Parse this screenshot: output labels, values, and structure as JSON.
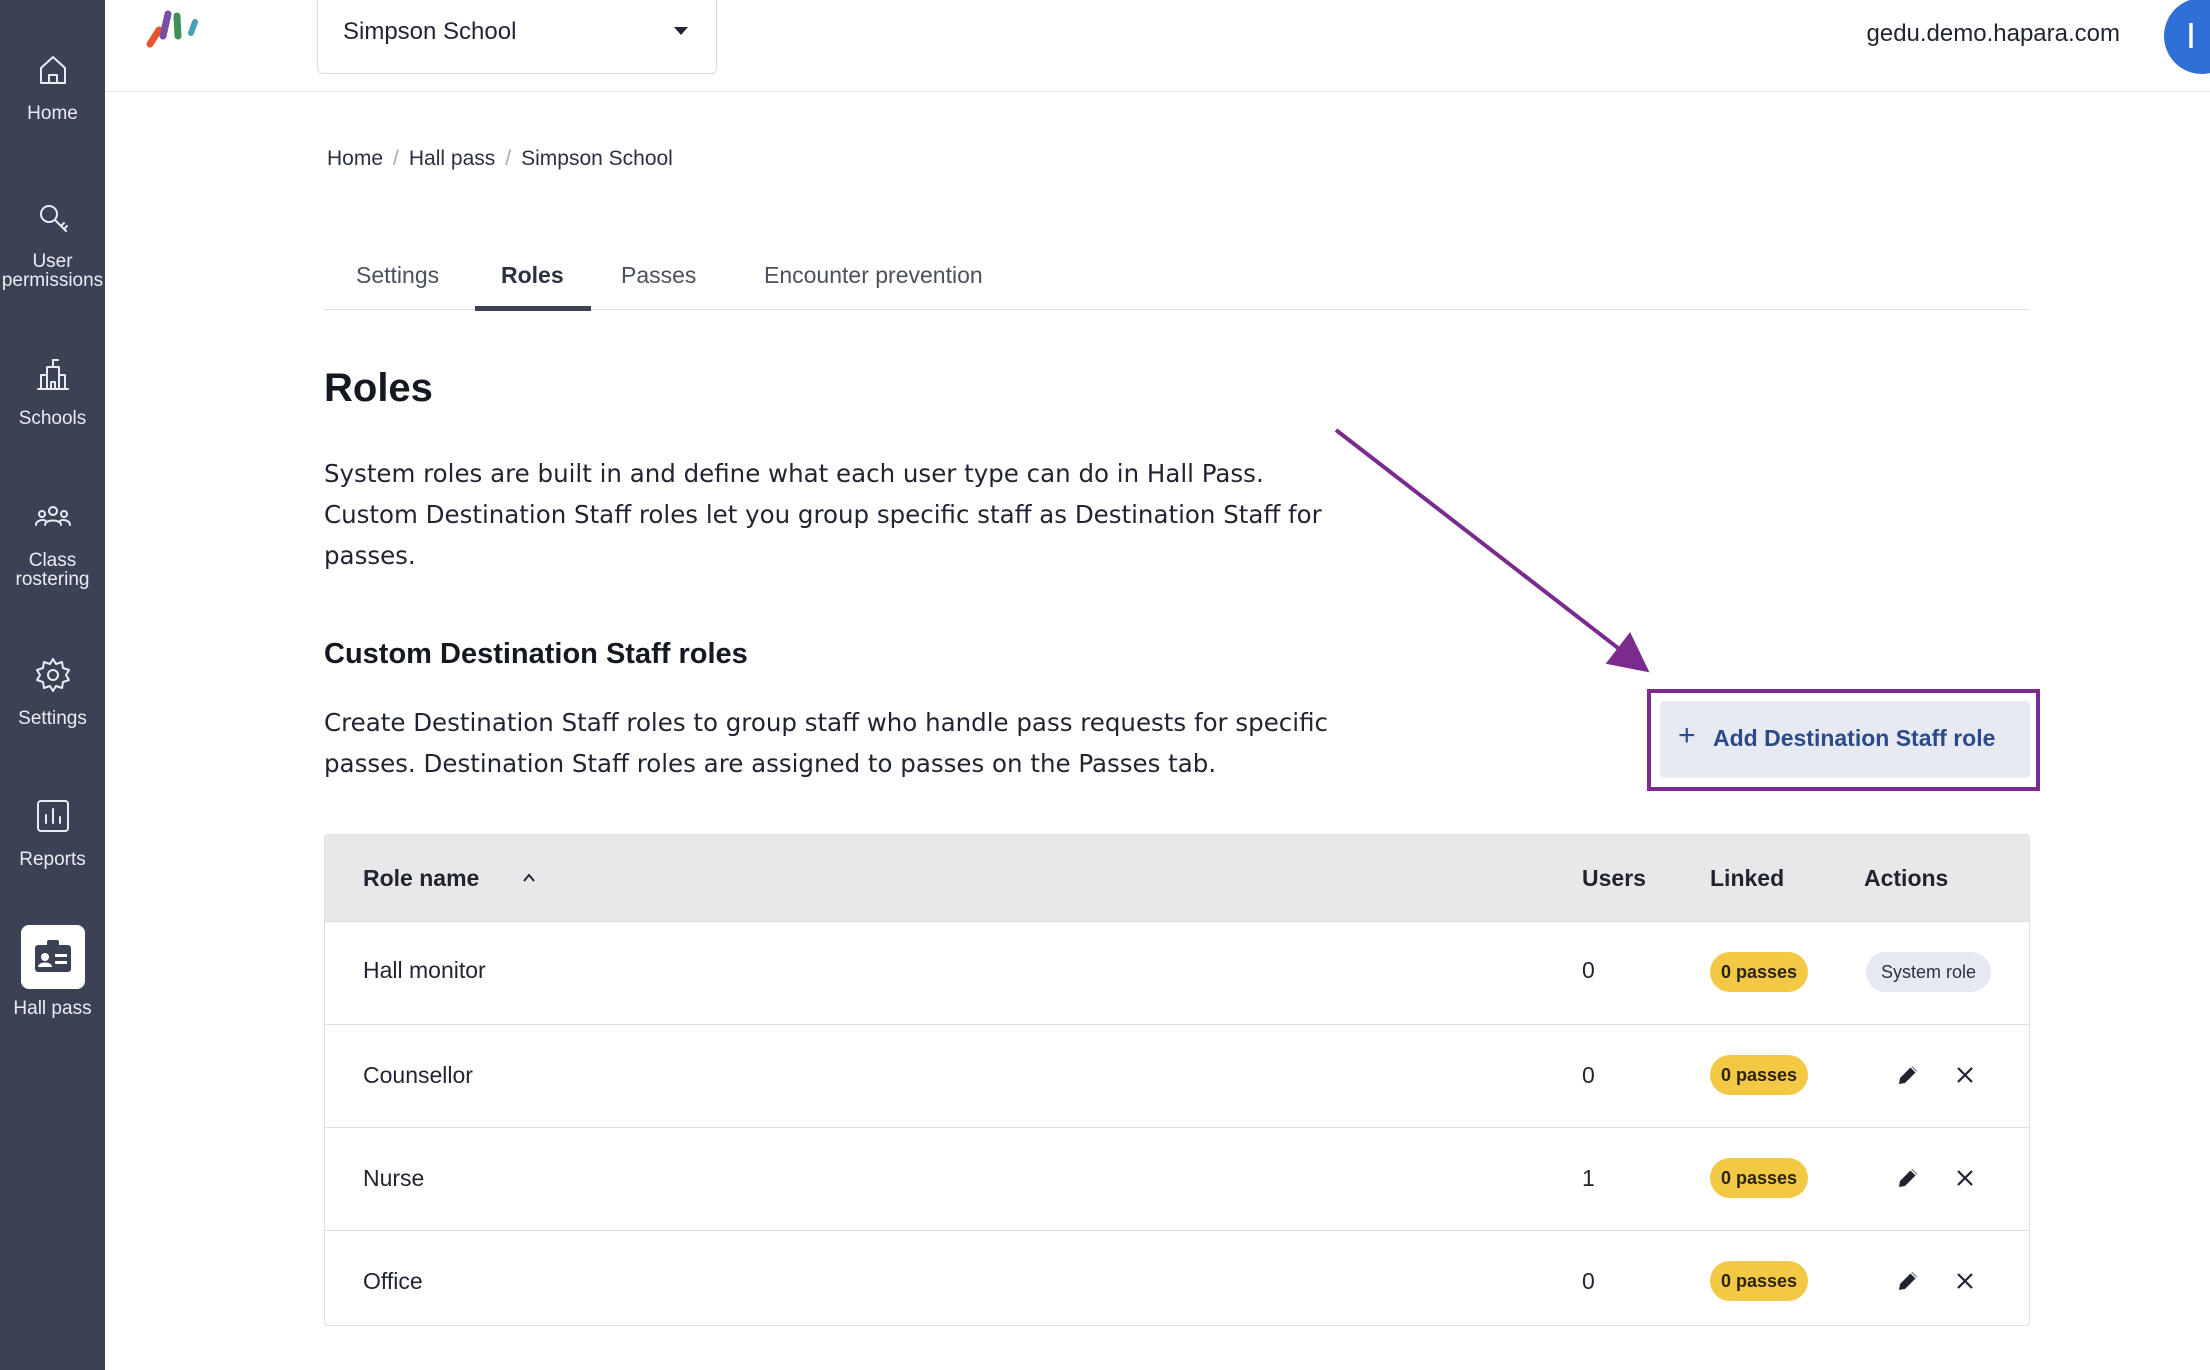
{
  "sidebar": {
    "items": [
      {
        "label": "Home",
        "icon": "home-icon"
      },
      {
        "label": "User\npermissions",
        "icon": "key-icon"
      },
      {
        "label": "Schools",
        "icon": "school-icon"
      },
      {
        "label": "Class\nrostering",
        "icon": "group-icon"
      },
      {
        "label": "Settings",
        "icon": "gear-icon"
      },
      {
        "label": "Reports",
        "icon": "chart-icon"
      },
      {
        "label": "Hall pass",
        "icon": "id-badge-icon",
        "active": true
      }
    ]
  },
  "topbar": {
    "school": "Simpson School",
    "domain": "gedu.demo.hapara.com",
    "avatar_initial": "I"
  },
  "breadcrumb": {
    "items": [
      "Home",
      "Hall pass",
      "Simpson School"
    ],
    "separator": "/"
  },
  "tabs": {
    "items": [
      "Settings",
      "Roles",
      "Passes",
      "Encounter prevention"
    ],
    "active": "Roles"
  },
  "page": {
    "title": "Roles",
    "intro": "System roles are built in and define what each user type can do in Hall Pass. Custom Destination Staff roles let you group specific staff as Destination Staff for passes.",
    "section_title": "Custom Destination Staff roles",
    "section_desc": "Create Destination Staff roles to group staff who handle pass requests for specific passes. Destination Staff roles are assigned to passes on the Passes tab.",
    "add_button": "Add Destination Staff role",
    "add_button_icon": "+"
  },
  "table": {
    "headers": {
      "role_name": "Role name",
      "users": "Users",
      "linked": "Linked",
      "actions": "Actions"
    },
    "rows": [
      {
        "name": "Hall monitor",
        "users": "0",
        "linked": "0 passes",
        "system_role": "System role"
      },
      {
        "name": "Counsellor",
        "users": "0",
        "linked": "0 passes"
      },
      {
        "name": "Nurse",
        "users": "1",
        "linked": "0 passes"
      },
      {
        "name": "Office",
        "users": "0",
        "linked": "0 passes"
      }
    ]
  },
  "colors": {
    "sidebar": "#3a4254",
    "annotation": "#7b2a8e",
    "badge": "#f3c845",
    "accent": "#2f6fd6"
  }
}
